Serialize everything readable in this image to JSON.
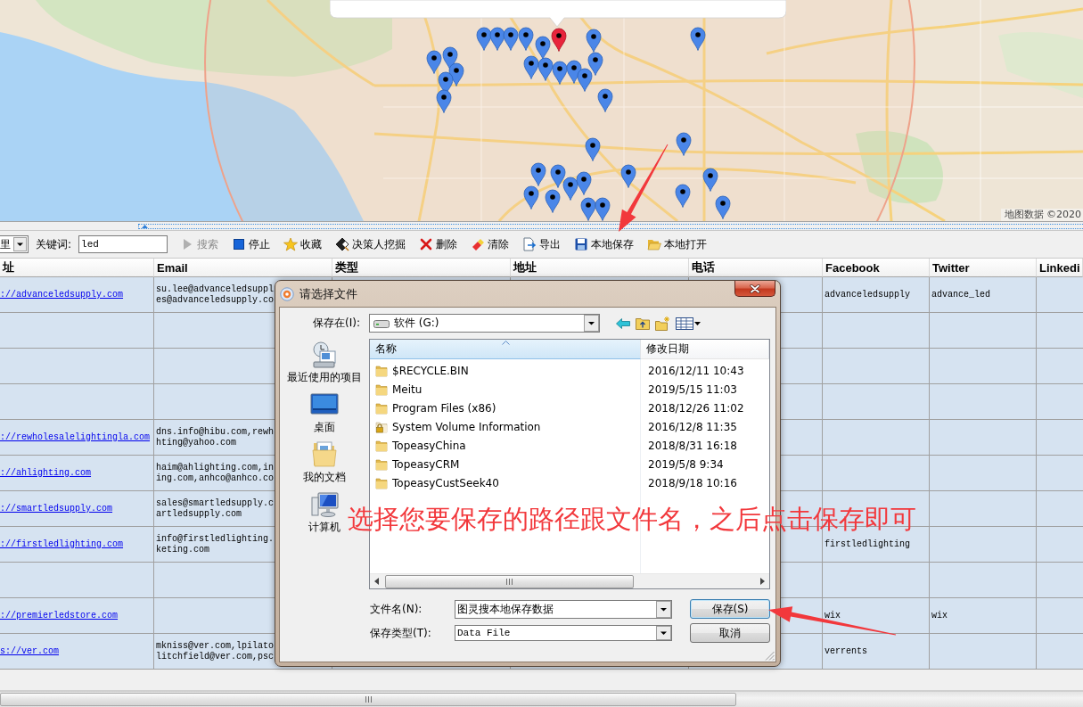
{
  "map": {
    "attribution": "地图数据 ©2020"
  },
  "toolbar": {
    "dropdown": {
      "value": "里"
    },
    "keyword": {
      "label": "关键词:",
      "value": "led"
    },
    "buttons": [
      {
        "kind": "search",
        "label": "搜索",
        "disabled": true
      },
      {
        "kind": "stop",
        "label": "停止",
        "disabled": false
      },
      {
        "kind": "favorite",
        "label": "收藏",
        "disabled": false
      },
      {
        "kind": "decision_maker",
        "label": "决策人挖掘",
        "disabled": false
      },
      {
        "kind": "delete",
        "label": "删除",
        "disabled": false
      },
      {
        "kind": "clear",
        "label": "清除",
        "disabled": false
      },
      {
        "kind": "export",
        "label": "导出",
        "disabled": false
      },
      {
        "kind": "save_local",
        "label": "本地保存",
        "disabled": false
      },
      {
        "kind": "open_local",
        "label": "本地打开",
        "disabled": false
      }
    ]
  },
  "table": {
    "columns": [
      "址",
      "Email",
      "类型",
      "地址",
      "电话",
      "Facebook",
      "Twitter",
      "Linkedi"
    ],
    "rows": [
      {
        "column_1": "://advanceledsupply.com",
        "email": "su.lee@advanceledsuppl\nes@advanceledsupply.co",
        "facebook": "advanceledsupply",
        "twitter": "advance_led"
      },
      {},
      {},
      {},
      {
        "column_1": "://rewholesalelightingla.com",
        "email": "dns.info@hibu.com,rewh\nhting@yahoo.com"
      },
      {
        "column_1": "://ahlighting.com",
        "email": "haim@ahlighting.com,in\ning.com,anhco@anhco.co"
      },
      {
        "column_1": "://smartledsupply.com",
        "email": "sales@smartledsupply.c\nartledsupply.com"
      },
      {
        "column_1": "://firstledlighting.com",
        "email": "info@firstledlighting.\nketing.com",
        "facebook": "firstledlighting"
      },
      {},
      {
        "column_1": "://premierledstore.com",
        "facebook": "wix",
        "twitter": "wix"
      },
      {
        "column_1": "s://ver.com",
        "email": "mkniss@ver.com,lpilato\nlitchfield@ver.com,psc",
        "facebook": "verrents"
      }
    ]
  },
  "dialog": {
    "title": "请选择文件",
    "save_in": {
      "label": "保存在(I):",
      "value": "软件 (G:)"
    },
    "places": [
      {
        "kind": "recent",
        "label": "最近使用的项目"
      },
      {
        "kind": "desktop",
        "label": "桌面"
      },
      {
        "kind": "documents",
        "label": "我的文档"
      },
      {
        "kind": "computer",
        "label": "计算机"
      }
    ],
    "file_list": {
      "columns": [
        {
          "label": "名称",
          "sorted": true
        },
        {
          "label": "修改日期",
          "sorted": false
        }
      ],
      "rows": [
        {
          "kind": "folder",
          "name": "$RECYCLE.BIN",
          "date": "2016/12/11 10:43"
        },
        {
          "kind": "folder",
          "name": "Meitu",
          "date": "2019/5/15 11:03"
        },
        {
          "kind": "folder",
          "name": "Program Files (x86)",
          "date": "2018/12/26 11:02"
        },
        {
          "kind": "locked_folder",
          "name": "System Volume Information",
          "date": "2016/12/8 11:35"
        },
        {
          "kind": "folder",
          "name": "TopeasyChina",
          "date": "2018/8/31 16:18"
        },
        {
          "kind": "folder",
          "name": "TopeasyCRM",
          "date": "2019/5/8 9:34"
        },
        {
          "kind": "folder",
          "name": "TopeasyCustSeek40",
          "date": "2018/9/18 10:16"
        }
      ]
    },
    "file_name": {
      "label": "文件名(N):",
      "value": "图灵搜本地保存数据"
    },
    "file_type": {
      "label": "保存类型(T):",
      "value": "Data File"
    },
    "buttons": [
      {
        "kind": "default",
        "label": "保存(S)"
      },
      {
        "kind": "normal",
        "label": "取消"
      }
    ]
  },
  "annotation": {
    "text": "选择您要保存的路径跟文件名，之后点击保存即可"
  }
}
